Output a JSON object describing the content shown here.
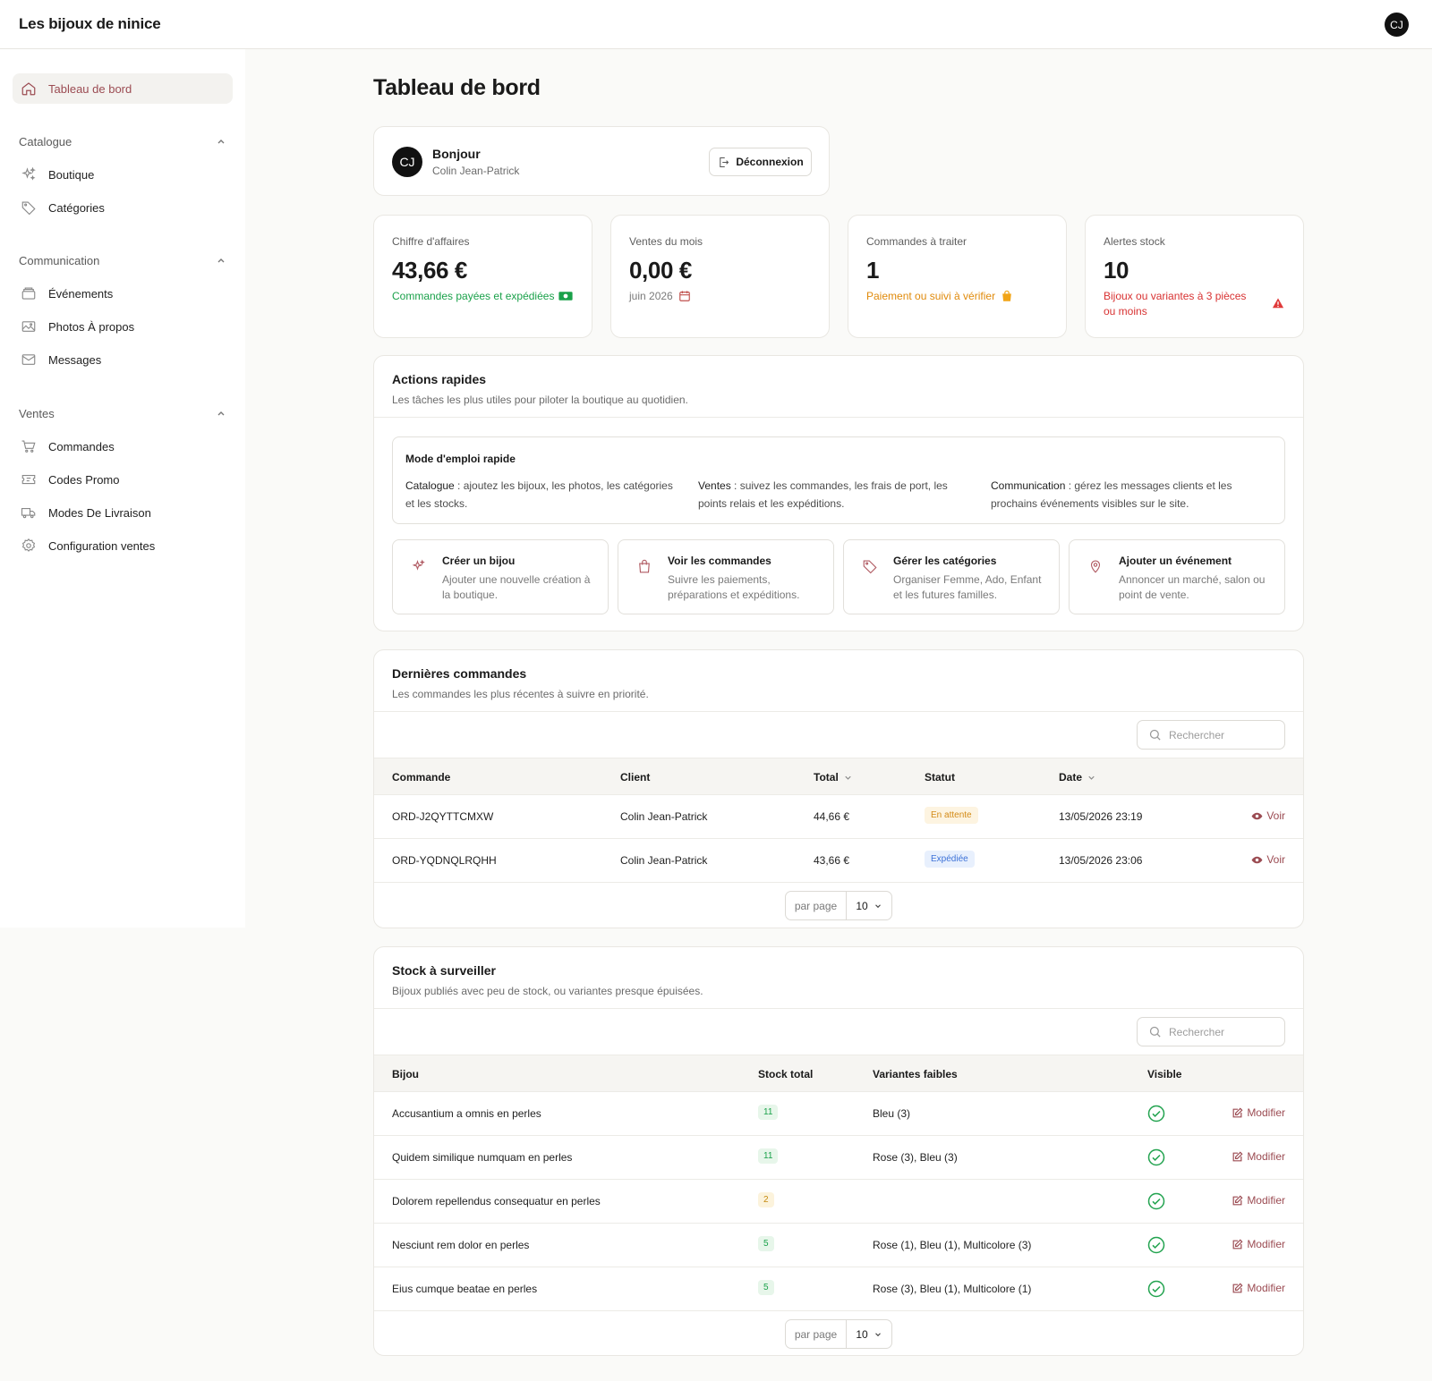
{
  "brand": "Les bijoux de ninice",
  "user_initials": "CJ",
  "sidebar": {
    "dashboard": "Tableau de bord",
    "groups": [
      {
        "label": "Catalogue",
        "items": [
          "Boutique",
          "Catégories"
        ]
      },
      {
        "label": "Communication",
        "items": [
          "Événements",
          "Photos À propos",
          "Messages"
        ]
      },
      {
        "label": "Ventes",
        "items": [
          "Commandes",
          "Codes Promo",
          "Modes De Livraison",
          "Configuration ventes"
        ]
      }
    ]
  },
  "page_title": "Tableau de bord",
  "greeting": {
    "hello": "Bonjour",
    "name": "Colin Jean-Patrick",
    "logout": "Déconnexion"
  },
  "stats": [
    {
      "label": "Chiffre d'affaires",
      "value": "43,66 €",
      "note": "Commandes payées et expédiées",
      "color": "#1aa14a"
    },
    {
      "label": "Ventes du mois",
      "value": "0,00 €",
      "note": "juin 2026",
      "color": "#7a7a7a"
    },
    {
      "label": "Commandes à traiter",
      "value": "1",
      "note": "Paiement ou suivi à vérifier",
      "color": "#e08a0b"
    },
    {
      "label": "Alertes stock",
      "value": "10",
      "note": "Bijoux ou variantes à 3 pièces ou moins",
      "color": "#d83232"
    }
  ],
  "quick": {
    "title": "Actions rapides",
    "desc": "Les tâches les plus utiles pour piloter la boutique au quotidien.",
    "guide_title": "Mode d'emploi rapide",
    "guide": [
      {
        "key": "Catalogue",
        "text": " : ajoutez les bijoux, les photos, les catégories et les stocks."
      },
      {
        "key": "Ventes",
        "text": " : suivez les commandes, les frais de port, les points relais et les expéditions."
      },
      {
        "key": "Communication",
        "text": " : gérez les messages clients et les prochains événements visibles sur le site."
      }
    ],
    "actions": [
      {
        "title": "Créer un bijou",
        "desc": "Ajouter une nouvelle création à la boutique.",
        "icon": "sparkles-icon"
      },
      {
        "title": "Voir les commandes",
        "desc": "Suivre les paiements, préparations et expéditions.",
        "icon": "shopping-bag-icon"
      },
      {
        "title": "Gérer les catégories",
        "desc": "Organiser Femme, Ado, Enfant et les futures familles.",
        "icon": "tag-icon"
      },
      {
        "title": "Ajouter un événement",
        "desc": "Annoncer un marché, salon ou point de vente.",
        "icon": "map-pin-icon"
      }
    ]
  },
  "orders": {
    "title": "Dernières commandes",
    "desc": "Les commandes les plus récentes à suivre en priorité.",
    "search_placeholder": "Rechercher",
    "columns": [
      "Commande",
      "Client",
      "Total",
      "Statut",
      "Date"
    ],
    "rows": [
      {
        "id": "ORD-J2QYTTCMXW",
        "client": "Colin Jean-Patrick",
        "total": "44,66 €",
        "status": "En attente",
        "date": "13/05/2026 23:19",
        "action": "Voir"
      },
      {
        "id": "ORD-YQDNQLRQHH",
        "client": "Colin Jean-Patrick",
        "total": "43,66 €",
        "status": "Expédiée",
        "date": "13/05/2026 23:06",
        "action": "Voir"
      }
    ],
    "per_page_label": "par page",
    "per_page": "10"
  },
  "stock": {
    "title": "Stock à surveiller",
    "desc": "Bijoux publiés avec peu de stock, ou variantes presque épuisées.",
    "search_placeholder": "Rechercher",
    "columns": [
      "Bijou",
      "Stock total",
      "Variantes faibles",
      "Visible"
    ],
    "rows": [
      {
        "name": "Accusantium a omnis en perles",
        "stock": "11",
        "variants": "Bleu (3)",
        "action": "Modifier"
      },
      {
        "name": "Quidem similique numquam en perles",
        "stock": "11",
        "variants": "Rose (3), Bleu (3)",
        "action": "Modifier"
      },
      {
        "name": "Dolorem repellendus consequatur en perles",
        "stock": "2",
        "variants": "",
        "action": "Modifier"
      },
      {
        "name": "Nesciunt rem dolor en perles",
        "stock": "5",
        "variants": "Rose (1), Bleu (1), Multicolore (3)",
        "action": "Modifier"
      },
      {
        "name": "Eius cumque beatae en perles",
        "stock": "5",
        "variants": "Rose (3), Bleu (1), Multicolore (1)",
        "action": "Modifier"
      }
    ],
    "per_page_label": "par page",
    "per_page": "10"
  }
}
